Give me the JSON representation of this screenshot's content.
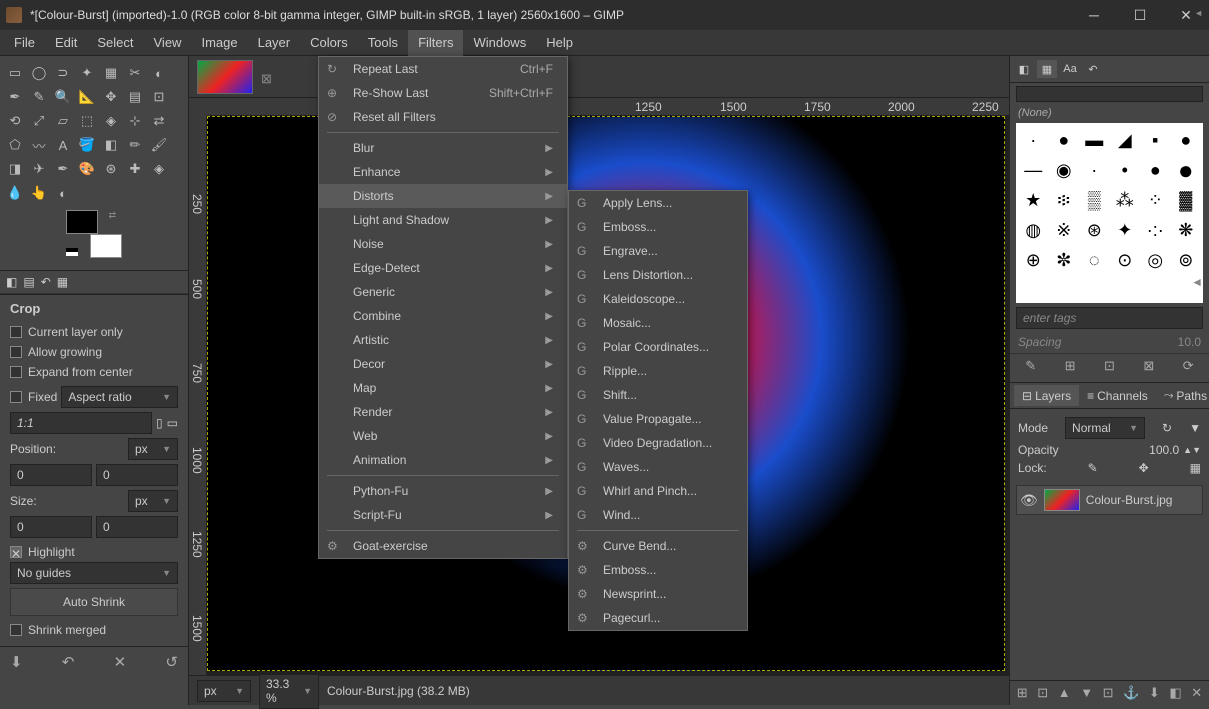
{
  "title": "*[Colour-Burst] (imported)-1.0 (RGB color 8-bit gamma integer, GIMP built-in sRGB, 1 layer) 2560x1600 – GIMP",
  "menubar": [
    "File",
    "Edit",
    "Select",
    "View",
    "Image",
    "Layer",
    "Colors",
    "Tools",
    "Filters",
    "Windows",
    "Help"
  ],
  "active_menu": "Filters",
  "filters_menu": {
    "repeat": "Repeat Last",
    "repeat_sc": "Ctrl+F",
    "reshow": "Re-Show Last",
    "reshow_sc": "Shift+Ctrl+F",
    "reset": "Reset all Filters",
    "groups": [
      "Blur",
      "Enhance",
      "Distorts",
      "Light and Shadow",
      "Noise",
      "Edge-Detect",
      "Generic",
      "Combine",
      "Artistic",
      "Decor",
      "Map",
      "Render",
      "Web",
      "Animation"
    ],
    "pyfu": "Python-Fu",
    "scfu": "Script-Fu",
    "goat": "Goat-exercise"
  },
  "distorts_submenu": [
    {
      "t": "Apply Lens...",
      "g": true
    },
    {
      "t": "Emboss...",
      "g": true
    },
    {
      "t": "Engrave...",
      "g": true
    },
    {
      "t": "Lens Distortion...",
      "g": true
    },
    {
      "t": "Kaleidoscope...",
      "g": true
    },
    {
      "t": "Mosaic...",
      "g": true
    },
    {
      "t": "Polar Coordinates...",
      "g": true
    },
    {
      "t": "Ripple...",
      "g": true
    },
    {
      "t": "Shift...",
      "g": true
    },
    {
      "t": "Value Propagate...",
      "g": true
    },
    {
      "t": "Video Degradation...",
      "g": true
    },
    {
      "t": "Waves...",
      "g": true
    },
    {
      "t": "Whirl and Pinch...",
      "g": true
    },
    {
      "t": "Wind...",
      "g": true
    },
    {
      "t": "Curve Bend...",
      "g": false
    },
    {
      "t": "Emboss...",
      "g": false
    },
    {
      "t": "Newsprint...",
      "g": false
    },
    {
      "t": "Pagecurl...",
      "g": false
    }
  ],
  "toolopt": {
    "title": "Crop",
    "chk1": "Current layer only",
    "chk2": "Allow growing",
    "chk3": "Expand from center",
    "fixed_lbl": "Fixed",
    "aspect": "Aspect ratio",
    "ratio": "1:1",
    "pos_lbl": "Position:",
    "px": "px",
    "pos_x": "0",
    "pos_y": "0",
    "size_lbl": "Size:",
    "size_w": "0",
    "size_h": "0",
    "hl": "Highlight",
    "noguides": "No guides",
    "autoshrink": "Auto Shrink",
    "shrinkmerged": "Shrink merged"
  },
  "statusbar": {
    "unit": "px",
    "zoom": "33.3 %",
    "file": "Colour-Burst.jpg (38.2 MB)"
  },
  "ruler_h": {
    "1250": "1250",
    "1500": "1500",
    "1750": "1750",
    "2000": "2000",
    "2250": "2250"
  },
  "ruler_v": {
    "250": "250",
    "500": "500",
    "750": "750",
    "1000": "1000",
    "1250": "1250",
    "1500": "1500"
  },
  "right": {
    "none": "(None)",
    "tags": "enter tags",
    "spacing_lbl": "Spacing",
    "spacing": "10.0",
    "tab_layers": "Layers",
    "tab_channels": "Channels",
    "tab_paths": "Paths",
    "mode": "Mode",
    "mode_val": "Normal",
    "opacity": "Opacity",
    "opacity_val": "100.0",
    "lock": "Lock:",
    "layer_name": "Colour-Burst.jpg"
  }
}
